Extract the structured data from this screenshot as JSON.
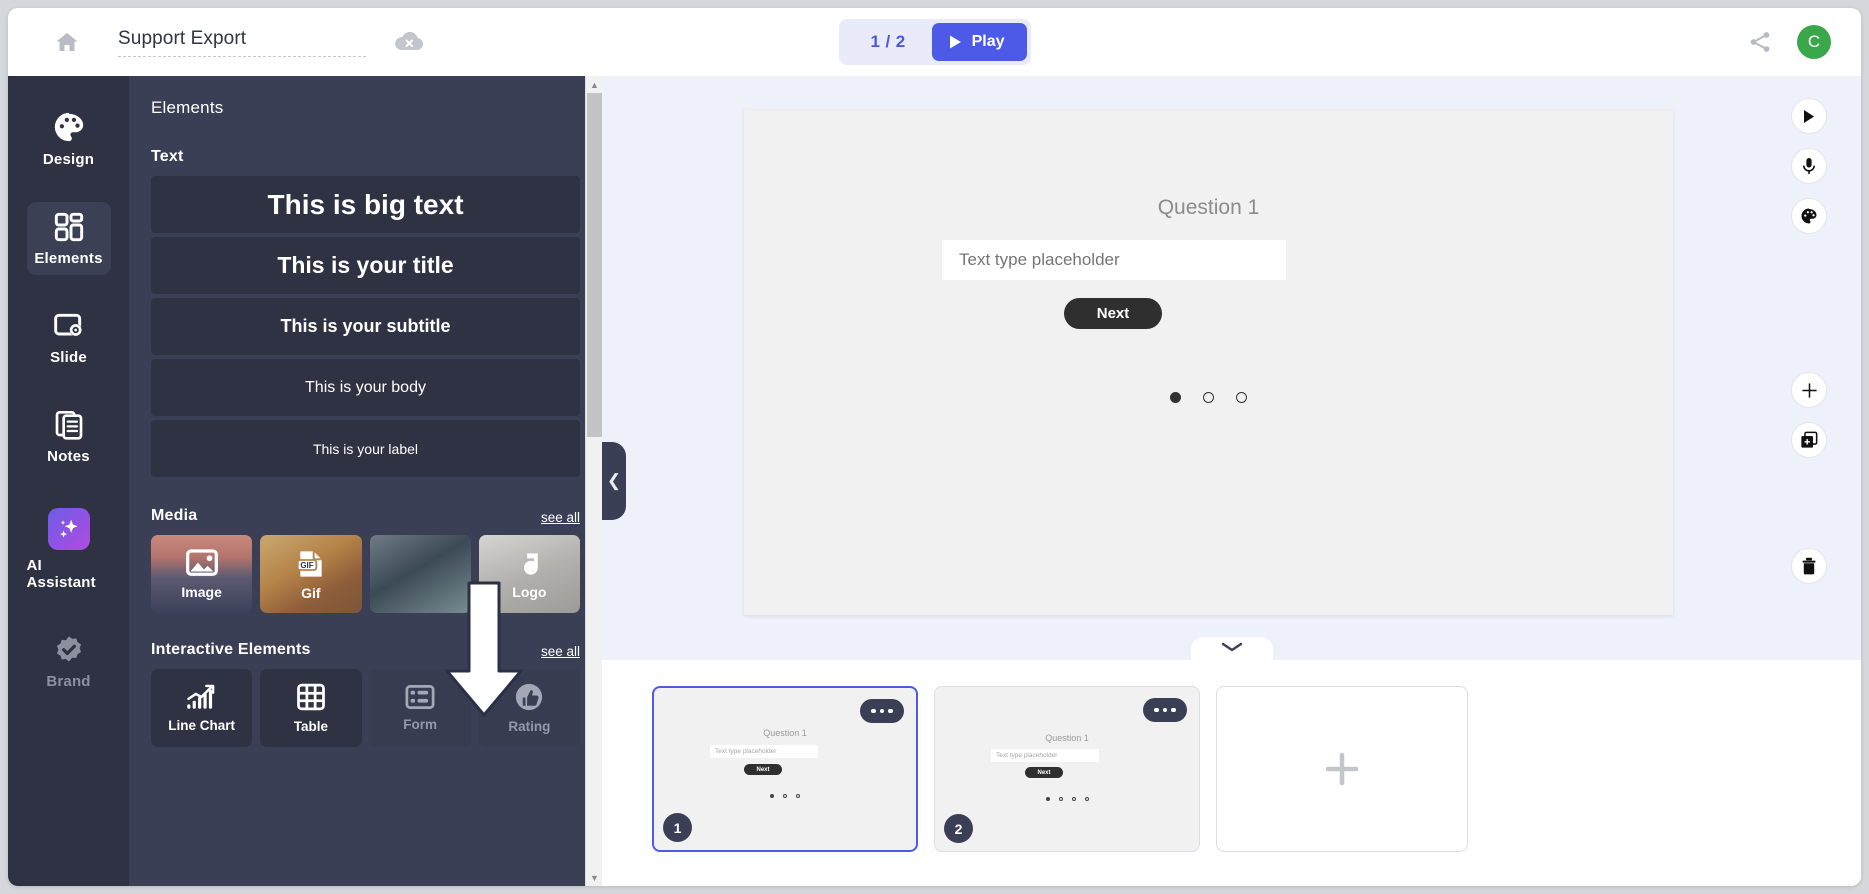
{
  "topbar": {
    "home_icon": "home-icon",
    "doc_title": "Support Export",
    "cloud_status_icon": "cloud-offline-icon",
    "page_indicator": "1 / 2",
    "play_label": "Play",
    "play_icon": "play-icon",
    "share_icon": "share-icon",
    "avatar_initial": "C",
    "avatar_color": "#3aa84a",
    "accent_color": "#4d5ae8"
  },
  "rail": {
    "items": [
      {
        "label": "Design",
        "icon": "palette-icon",
        "active": false,
        "disabled": false
      },
      {
        "label": "Elements",
        "icon": "grid-icon",
        "active": true,
        "disabled": false
      },
      {
        "label": "Slide",
        "icon": "slide-gear-icon",
        "active": false,
        "disabled": false
      },
      {
        "label": "Notes",
        "icon": "notes-icon",
        "active": false,
        "disabled": false
      },
      {
        "label": "AI Assistant",
        "icon": "sparkle-icon",
        "active": false,
        "disabled": false
      },
      {
        "label": "Brand",
        "icon": "verified-icon",
        "active": false,
        "disabled": true
      }
    ]
  },
  "panel": {
    "title": "Elements",
    "text_section": {
      "title": "Text",
      "items": [
        {
          "label": "This is big text"
        },
        {
          "label": "This is your title"
        },
        {
          "label": "This is your subtitle"
        },
        {
          "label": "This is your body"
        },
        {
          "label": "This is your label"
        }
      ]
    },
    "media_section": {
      "title": "Media",
      "see_all": "see all",
      "items": [
        {
          "label": "Image",
          "icon": "image-icon"
        },
        {
          "label": "Gif",
          "icon": "gif-icon"
        },
        {
          "label": "",
          "icon": "video-icon"
        },
        {
          "label": "Logo",
          "icon": "logo-icon"
        }
      ]
    },
    "interactive_section": {
      "title": "Interactive Elements",
      "see_all": "see all",
      "items": [
        {
          "label": "Line Chart",
          "icon": "line-chart-icon",
          "disabled": false
        },
        {
          "label": "Table",
          "icon": "table-icon",
          "disabled": false
        },
        {
          "label": "Form",
          "icon": "form-icon",
          "disabled": true
        },
        {
          "label": "Rating",
          "icon": "rating-icon",
          "disabled": true
        }
      ]
    },
    "collapse_icon": "chevron-left-icon"
  },
  "canvas": {
    "question_label": "Question 1",
    "input_placeholder": "Text type placeholder",
    "next_label": "Next",
    "dots_total": 3,
    "dots_active_index": 0
  },
  "stage_tools": [
    {
      "icon": "play-icon"
    },
    {
      "icon": "microphone-icon"
    },
    {
      "icon": "palette-icon"
    },
    {
      "icon": "plus-icon"
    },
    {
      "icon": "duplicate-icon"
    },
    {
      "icon": "trash-icon"
    }
  ],
  "tray": {
    "collapse_icon": "chevron-down-icon",
    "slides": [
      {
        "number": "1",
        "selected": true,
        "question_label": "Question 1",
        "input_placeholder": "Text type placeholder",
        "next_label": "Next",
        "dots_total": 3,
        "menu_icon": "more-icon"
      },
      {
        "number": "2",
        "selected": false,
        "question_label": "Question 1",
        "input_placeholder": "Text type placeholder",
        "next_label": "Next",
        "dots_total": 4,
        "menu_icon": "more-icon"
      }
    ],
    "add_slide_icon": "plus-icon"
  },
  "annotation": {
    "arrow_icon": "down-arrow-annotation"
  }
}
